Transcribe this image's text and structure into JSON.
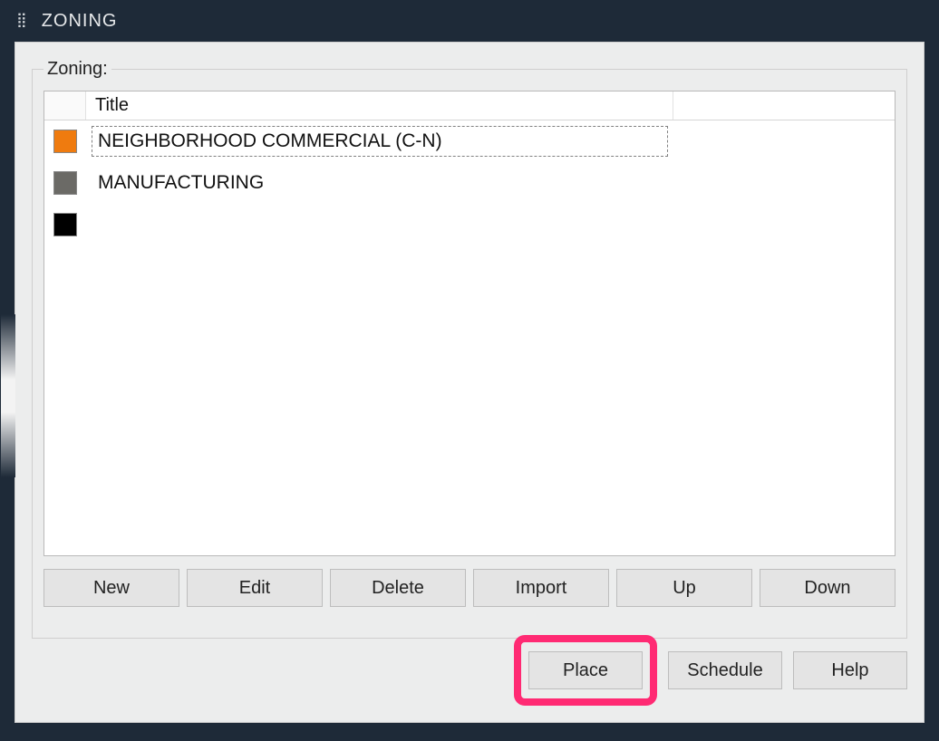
{
  "window": {
    "title": "ZONING"
  },
  "group": {
    "legend": "Zoning:"
  },
  "list": {
    "columns": {
      "title": "Title"
    },
    "rows": [
      {
        "color": "#ef7b0f",
        "title": "NEIGHBORHOOD COMMERCIAL (C-N)",
        "selected": true
      },
      {
        "color": "#6b6a66",
        "title": "MANUFACTURING",
        "selected": false
      },
      {
        "color": "#000000",
        "title": "",
        "selected": false
      }
    ]
  },
  "buttons": {
    "new": "New",
    "edit": "Edit",
    "delete": "Delete",
    "import": "Import",
    "up": "Up",
    "down": "Down",
    "place": "Place",
    "schedule": "Schedule",
    "help": "Help"
  },
  "highlight": "place"
}
